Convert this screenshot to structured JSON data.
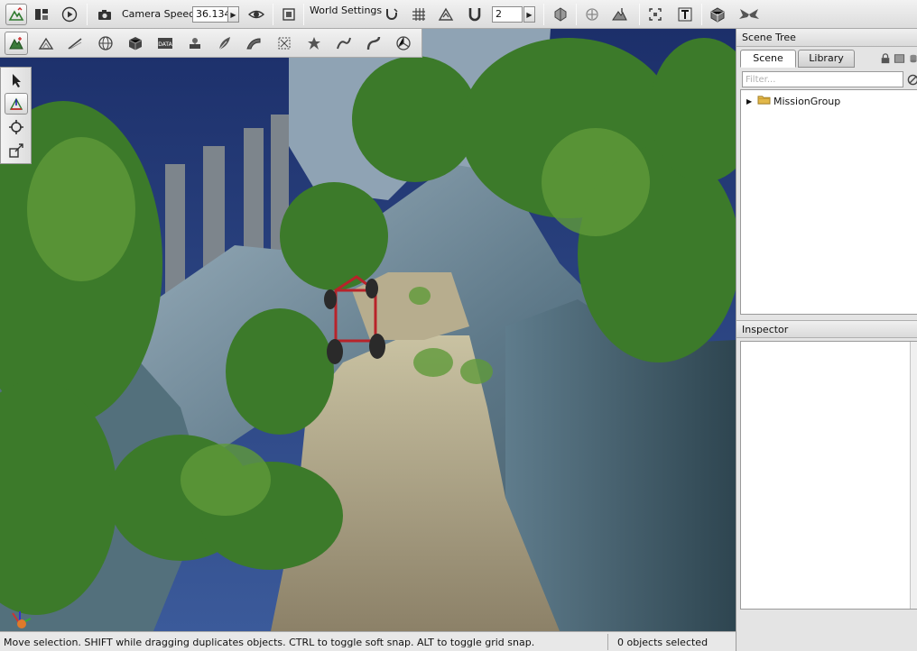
{
  "toolbar": {
    "camera_speed_label": "Camera Speed",
    "camera_speed_value": "36.134",
    "world_settings_label": "World Settings",
    "snap_value": "2"
  },
  "status": {
    "message": "Move selection.  SHIFT while dragging duplicates objects.  CTRL to toggle soft snap.  ALT to toggle grid snap.",
    "selection_count": "0 objects selected"
  },
  "scene_tree": {
    "title": "Scene Tree",
    "tabs": [
      {
        "label": "Scene",
        "active": true
      },
      {
        "label": "Library",
        "active": false
      }
    ],
    "filter_placeholder": "Filter...",
    "items": [
      {
        "label": "MissionGroup",
        "icon": "folder-icon",
        "collapsed": true
      }
    ]
  },
  "inspector": {
    "title": "Inspector"
  },
  "colors": {
    "sky": "#243c78",
    "rock": "#6d8694",
    "foliage": "#3f7a2c",
    "dirt_path": "#a89a78",
    "vehicle": "#b8232a"
  },
  "icons": {
    "top_toolbar": [
      "world-editor-icon",
      "gui-editor-icon",
      "play-icon",
      "camera-icon",
      "visibility-icon",
      "fit-view-icon",
      "magnet-soft-snap-icon",
      "grid-snap-icon",
      "terrain-snap-icon",
      "snap-magnet-icon",
      "object-bounds-icon",
      "selection-center-icon",
      "align-terrain-icon",
      "fit-selection-icon",
      "text-icon",
      "mesh-import-icon",
      "wings-icon"
    ],
    "terrain_toolbar": [
      "terrain-editor-icon",
      "terrain-painter-icon",
      "road-tool-icon",
      "globe-icon",
      "cube-icon",
      "datablock-editor-icon",
      "particle-editor-icon",
      "forest-editor-icon",
      "decal-road-icon",
      "mesh-road-icon",
      "river-editor-icon",
      "decal-icon",
      "convex-editor-icon",
      "navmesh-icon"
    ],
    "tool_palette": [
      "select-arrow-icon",
      "move-gizmo-icon",
      "rotate-gizmo-icon",
      "scale-gizmo-icon"
    ]
  }
}
